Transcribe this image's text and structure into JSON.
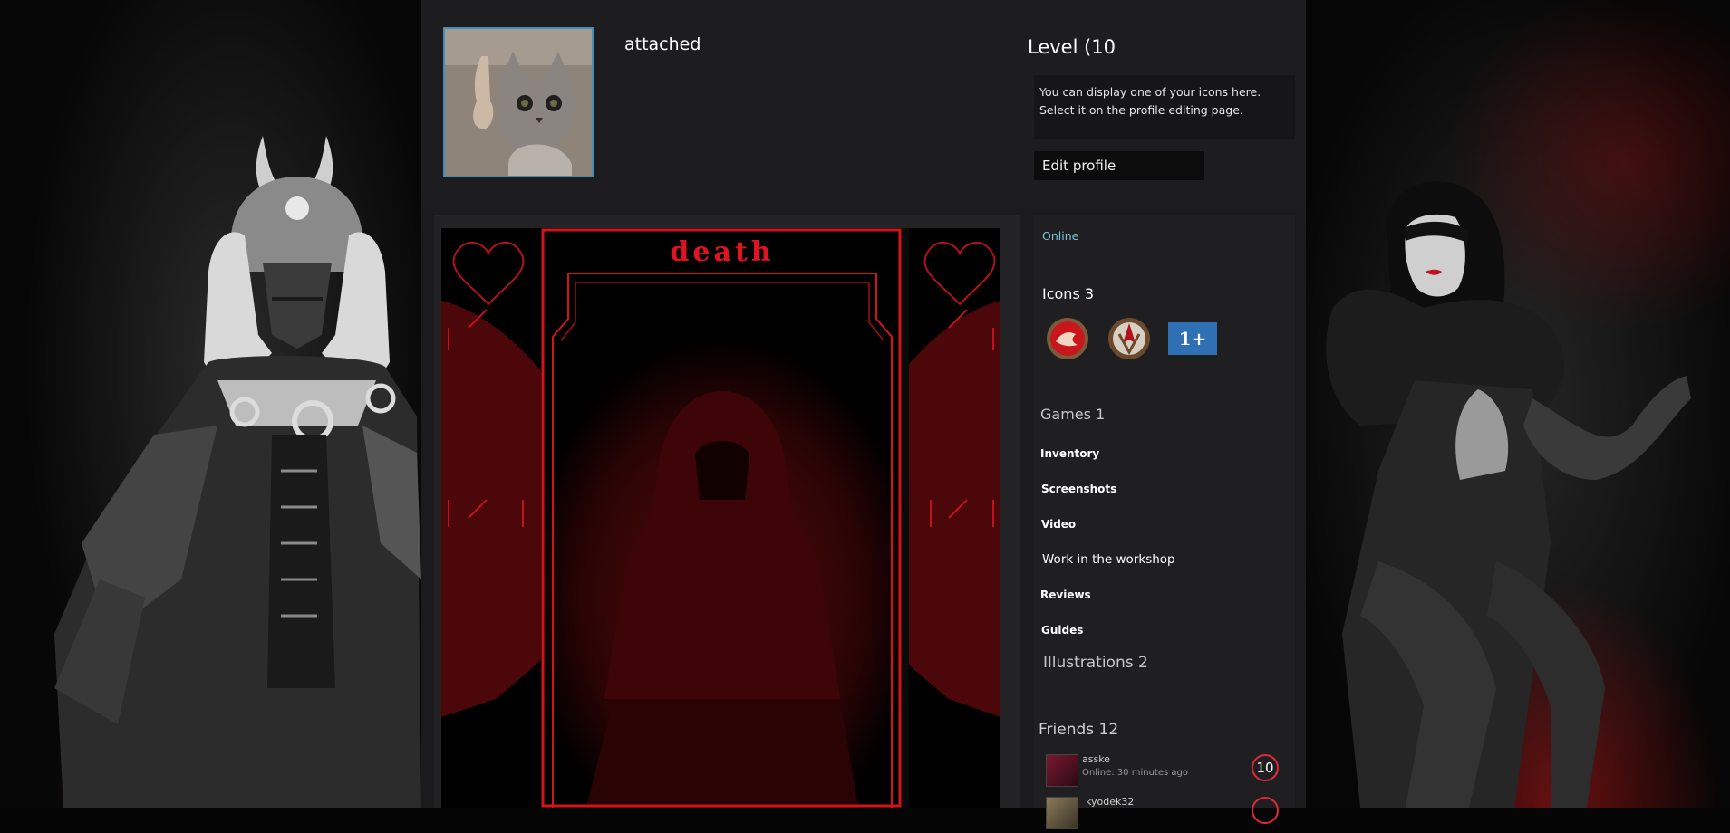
{
  "profile": {
    "username": "attached",
    "level_label": "Level (10",
    "icon_hint_line1": "You can display one of your icons here.",
    "icon_hint_line2": "Select it on the profile editing page.",
    "edit_profile_label": "Edit profile"
  },
  "showcase": {
    "artwork_title": "death"
  },
  "sidebar": {
    "status": "Online",
    "icons_title": "Icons 3",
    "icon_badges": [
      "red-dragon-badge-icon",
      "bronze-emblem-badge-icon",
      "1-plus-badge-icon"
    ],
    "badge_plus_text": "1+",
    "games_label": "Games 1",
    "inventory_label": "Inventory",
    "screenshots_label": "Screenshots",
    "video_label": "Video",
    "workshop_label": "Work in the workshop",
    "reviews_label": "Reviews",
    "guides_label": "Guides",
    "illustrations_label": "Illustrations 2",
    "friends_title": "Friends 12",
    "friends": [
      {
        "name": "asske",
        "status": "Online: 30 minutes ago",
        "level": "10"
      },
      {
        "name": "kyodek32",
        "status": "",
        "level": ""
      }
    ]
  },
  "colors": {
    "status_online": "#7ac5dc",
    "avatar_border": "#4a8cb8",
    "accent_red": "#e0283a",
    "artwork_red": "#d0141e"
  }
}
